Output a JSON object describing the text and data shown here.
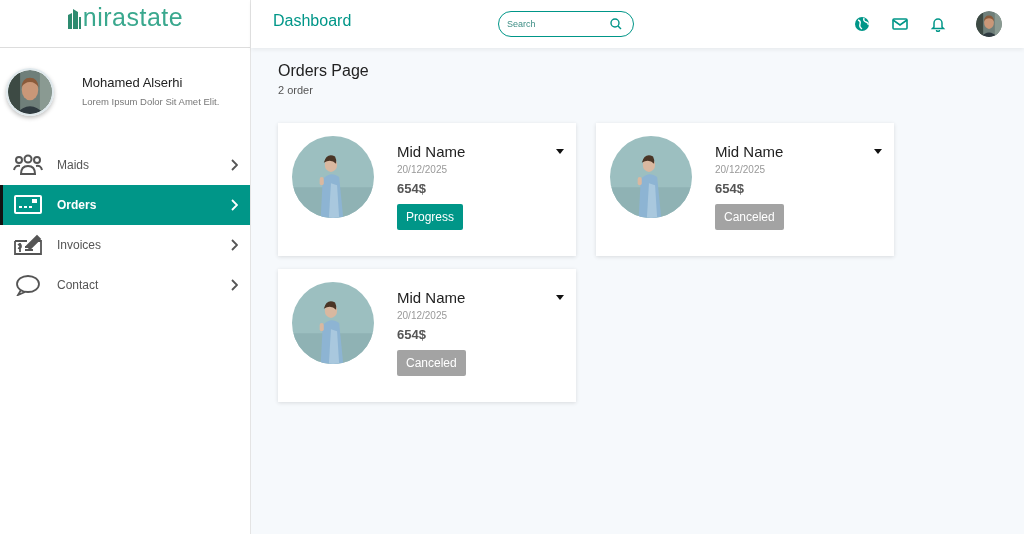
{
  "logo": {
    "text": "nirastate"
  },
  "user": {
    "name": "Mohamed Alserhi",
    "subtitle": "Lorem Ipsum Dolor Sit Amet Elit."
  },
  "nav": [
    {
      "label": "Maids",
      "kind": "people",
      "selected": false
    },
    {
      "label": "Orders",
      "kind": "card",
      "selected": true
    },
    {
      "label": "Invoices",
      "kind": "invoice",
      "selected": false
    },
    {
      "label": "Contact",
      "kind": "chat",
      "selected": false
    }
  ],
  "header": {
    "title": "Dashboard",
    "search": {
      "placeholder": "Search"
    }
  },
  "page": {
    "title": "Orders Page",
    "subtitle": "2 order"
  },
  "orders": [
    {
      "name": "Mid Name",
      "date": "20/12/2025",
      "price": "654$",
      "status": {
        "label": "Progress",
        "kind": "progress"
      }
    },
    {
      "name": "Mid Name",
      "date": "20/12/2025",
      "price": "654$",
      "status": {
        "label": "Canceled",
        "kind": "canceled"
      }
    },
    {
      "name": "Mid Name",
      "date": "20/12/2025",
      "price": "654$",
      "status": {
        "label": "Canceled",
        "kind": "canceled"
      }
    }
  ]
}
